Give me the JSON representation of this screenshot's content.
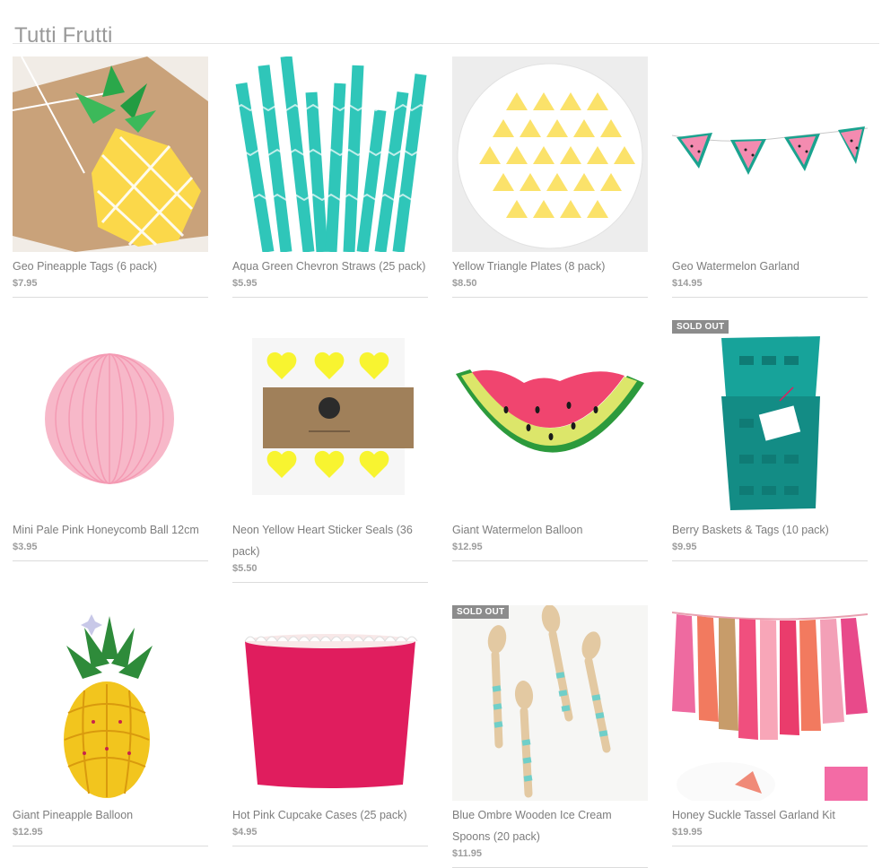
{
  "page": {
    "title": "Tutti Frutti"
  },
  "products": [
    {
      "name": "Geo Pineapple Tags (6 pack)",
      "price": "$7.95",
      "badge": ""
    },
    {
      "name": "Aqua Green Chevron Straws (25 pack)",
      "price": "$5.95",
      "badge": ""
    },
    {
      "name": "Yellow Triangle Plates (8 pack)",
      "price": "$8.50",
      "badge": ""
    },
    {
      "name": "Geo Watermelon Garland",
      "price": "$14.95",
      "badge": ""
    },
    {
      "name": "Mini Pale Pink Honeycomb Ball 12cm",
      "price": "$3.95",
      "badge": ""
    },
    {
      "name": "Neon Yellow Heart Sticker Seals (36 pack)",
      "price": "$5.50",
      "badge": ""
    },
    {
      "name": "Giant Watermelon Balloon",
      "price": "$12.95",
      "badge": ""
    },
    {
      "name": "Berry Baskets & Tags (10 pack)",
      "price": "$9.95",
      "badge": "SOLD OUT"
    },
    {
      "name": "Giant Pineapple Balloon",
      "price": "$12.95",
      "badge": ""
    },
    {
      "name": "Hot Pink Cupcake Cases (25 pack)",
      "price": "$4.95",
      "badge": ""
    },
    {
      "name": "Blue Ombre Wooden Ice Cream Spoons (20 pack)",
      "price": "$11.95",
      "badge": "SOLD OUT"
    },
    {
      "name": "Honey Suckle Tassel Garland Kit",
      "price": "$19.95",
      "badge": ""
    }
  ],
  "icons": [
    "pineapple-tag-image",
    "chevron-straws-image",
    "triangle-plate-image",
    "watermelon-garland-image",
    "honeycomb-ball-image",
    "heart-stickers-image",
    "watermelon-balloon-image",
    "berry-baskets-image",
    "pineapple-balloon-image",
    "cupcake-case-image",
    "wooden-spoons-image",
    "tassel-garland-image"
  ],
  "colors": {
    "aqua": "#2fc6b9",
    "teal": "#17a39a",
    "yellow": "#fbe26a",
    "pink": "#f48bb0",
    "hotpink": "#e01d5e",
    "kraft": "#c9a27a"
  }
}
